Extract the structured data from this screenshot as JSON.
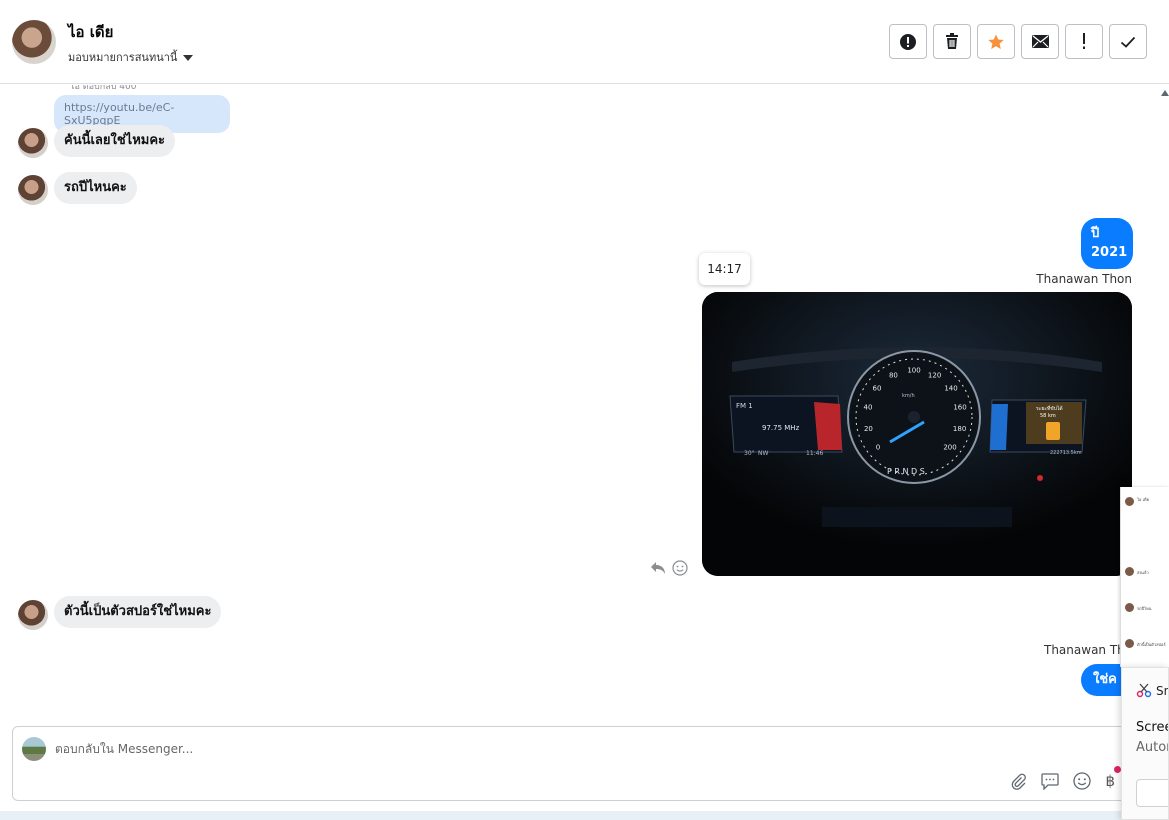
{
  "header": {
    "contact_name": "ไอ เดีย",
    "assign_label": "มอบหมายการสนทนานี้",
    "actions": [
      {
        "icon": "alert-circle-icon"
      },
      {
        "icon": "trash-icon"
      },
      {
        "icon": "star-icon",
        "color": "#f7923a"
      },
      {
        "icon": "envelope-icon"
      },
      {
        "icon": "exclamation-icon"
      },
      {
        "icon": "check-icon"
      }
    ]
  },
  "messages": {
    "reply_preview_label": "ไอ ตอบกลับ 400",
    "reply_link": "https://youtu.be/eC-SxU5pqpE",
    "incoming_1": "คันนี้เลยใช่ไหมคะ",
    "incoming_2": "รถปีไหนคะ",
    "outgoing_1_line1": "ปี",
    "outgoing_1_line2": "2021",
    "sender_1": "Thanawan Thon",
    "timestamp_tooltip": "14:17",
    "incoming_3": "ตัวนี้เป็นตัวสปอร์ใช่ไหมคะ",
    "sender_2": "Thanawan Tho",
    "outgoing_2": "ใช่ค"
  },
  "photo": {
    "radio_band": "FM 1",
    "radio_freq": "97.75 MHz",
    "outside_temp": "30°",
    "compass": "NW",
    "clock": "11:46",
    "speed_unit": "km/h",
    "gear": "P R N D S",
    "range_label": "ระยะที่ขับได้",
    "range_value": "58 km",
    "odometer": "222713.5km",
    "speed_ticks": [
      "0",
      "20",
      "40",
      "60",
      "80",
      "100",
      "120",
      "140",
      "160",
      "180",
      "200"
    ]
  },
  "composer": {
    "placeholder": "ตอบกลับใน Messenger...",
    "tools": [
      "paperclip-icon",
      "speech-bubble-icon",
      "emoji-icon",
      "baht-icon"
    ],
    "baht_symbol": "฿"
  },
  "mini_panel": {
    "rows": [
      "ไอ เดีย",
      "ส่งแล้ว",
      "รถปีไหน",
      "ตัวนี้เป็นตัวสปอร์"
    ]
  },
  "toast": {
    "app": "Sn",
    "title": "Scree",
    "subtitle": "Autor"
  }
}
